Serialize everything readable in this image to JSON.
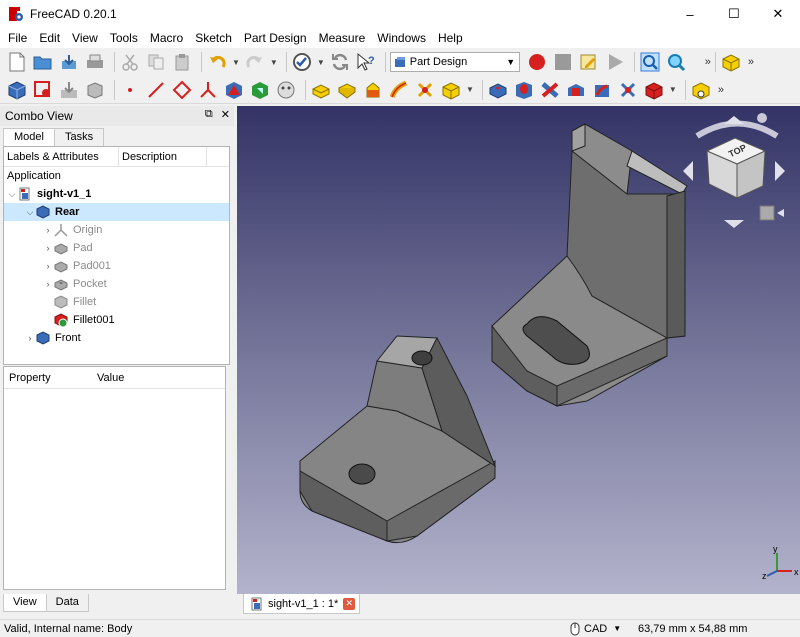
{
  "window": {
    "title": "FreeCAD 0.20.1",
    "minimize": "–",
    "maximize": "☐",
    "close": "✕"
  },
  "menu": [
    "File",
    "Edit",
    "View",
    "Tools",
    "Macro",
    "Sketch",
    "Part Design",
    "Measure",
    "Windows",
    "Help"
  ],
  "toolbar": {
    "workbench": "Part Design",
    "overflow": "»"
  },
  "combo_view": {
    "title": "Combo View",
    "tabs": [
      "Model",
      "Tasks"
    ],
    "tree_columns": [
      "Labels & Attributes",
      "Description"
    ],
    "section": "Application",
    "items": [
      {
        "label": "sight-v1_1",
        "icon": "document-icon"
      },
      {
        "label": "Rear",
        "icon": "body-icon"
      },
      {
        "label": "Origin",
        "icon": "origin-icon"
      },
      {
        "label": "Pad",
        "icon": "pad-icon"
      },
      {
        "label": "Pad001",
        "icon": "pad-icon"
      },
      {
        "label": "Pocket",
        "icon": "pocket-icon"
      },
      {
        "label": "Fillet",
        "icon": "fillet-icon"
      },
      {
        "label": "Fillet001",
        "icon": "fillet-icon"
      },
      {
        "label": "Front",
        "icon": "body-icon"
      }
    ],
    "property_columns": [
      "Property",
      "Value"
    ],
    "bottom_tabs": [
      "View",
      "Data"
    ]
  },
  "viewport": {
    "navcube_face": "TOP",
    "axis_labels": [
      "y",
      "x",
      "z"
    ]
  },
  "doc_tab": {
    "label": "sight-v1_1 : 1*",
    "close": "✕"
  },
  "status": {
    "message": "Valid, Internal name: Body",
    "nav_style": "CAD",
    "dimensions": "63,79 mm x 54,88 mm"
  },
  "colors": {
    "viewport_top": "#333366",
    "viewport_bottom": "#b3b3cc",
    "selection": "#cce8ff",
    "record_red": "#d62020"
  }
}
